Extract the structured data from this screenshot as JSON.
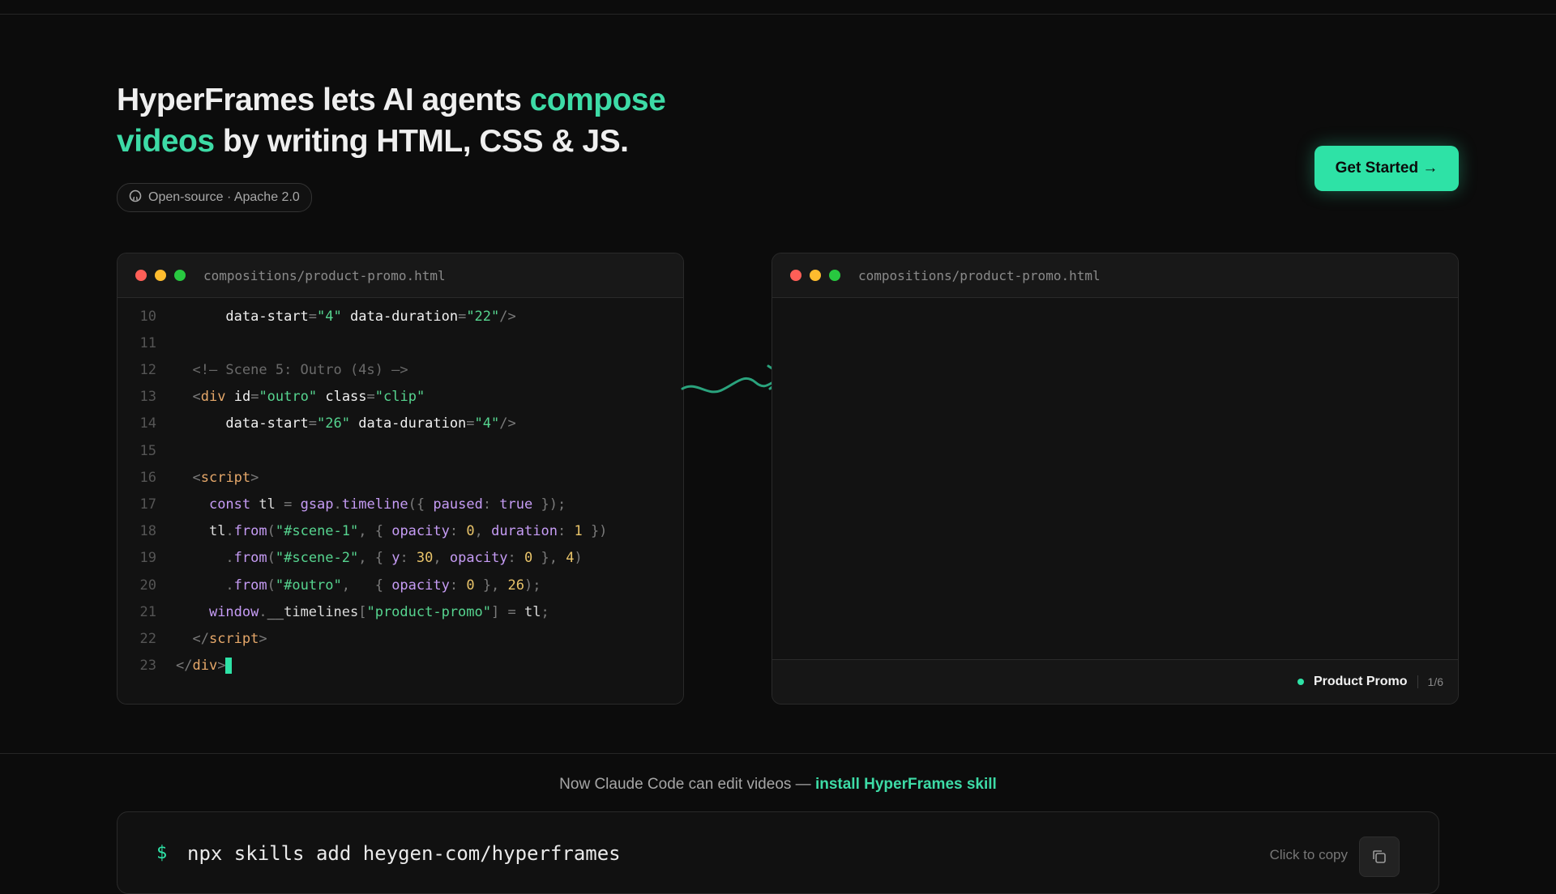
{
  "hero": {
    "headline_part1": "HyperFrames lets AI agents ",
    "headline_accent1": "compose videos",
    "headline_part2": " by writing HTML, CSS & JS.",
    "license": "Open-source · Apache 2.0",
    "cta": "Get Started →"
  },
  "code_window": {
    "filename": "compositions/product-promo.html",
    "lines": [
      {
        "n": "10",
        "tokens": [
          [
            "",
            "      "
          ],
          [
            "tk-attr",
            "data-start"
          ],
          [
            "tk-pun",
            "="
          ],
          [
            "tk-str",
            "\"4\""
          ],
          [
            "",
            " "
          ],
          [
            "tk-attr",
            "data-duration"
          ],
          [
            "tk-pun",
            "="
          ],
          [
            "tk-str",
            "\"22\""
          ],
          [
            "tk-pun",
            "/>"
          ]
        ]
      },
      {
        "n": "11",
        "tokens": []
      },
      {
        "n": "12",
        "tokens": [
          [
            "",
            "  "
          ],
          [
            "tk-com",
            "<!— Scene 5: Outro (4s) —>"
          ]
        ]
      },
      {
        "n": "13",
        "tokens": [
          [
            "",
            "  "
          ],
          [
            "tk-pun",
            "<"
          ],
          [
            "tk-tag",
            "div"
          ],
          [
            "",
            " "
          ],
          [
            "tk-attr",
            "id"
          ],
          [
            "tk-pun",
            "="
          ],
          [
            "tk-str",
            "\"outro\""
          ],
          [
            "",
            " "
          ],
          [
            "tk-attr",
            "class"
          ],
          [
            "tk-pun",
            "="
          ],
          [
            "tk-str",
            "\"clip\""
          ]
        ]
      },
      {
        "n": "14",
        "tokens": [
          [
            "",
            "      "
          ],
          [
            "tk-attr",
            "data-start"
          ],
          [
            "tk-pun",
            "="
          ],
          [
            "tk-str",
            "\"26\""
          ],
          [
            "",
            " "
          ],
          [
            "tk-attr",
            "data-duration"
          ],
          [
            "tk-pun",
            "="
          ],
          [
            "tk-str",
            "\"4\""
          ],
          [
            "tk-pun",
            "/>"
          ]
        ]
      },
      {
        "n": "15",
        "tokens": []
      },
      {
        "n": "16",
        "tokens": [
          [
            "",
            "  "
          ],
          [
            "tk-pun",
            "<"
          ],
          [
            "tk-tag",
            "script"
          ],
          [
            "tk-pun",
            ">"
          ]
        ]
      },
      {
        "n": "17",
        "tokens": [
          [
            "",
            "    "
          ],
          [
            "tk-kw",
            "const"
          ],
          [
            "tk-id",
            " tl "
          ],
          [
            "tk-pun",
            "= "
          ],
          [
            "tk-kw",
            "gsap"
          ],
          [
            "tk-pun",
            "."
          ],
          [
            "tk-kw",
            "timeline"
          ],
          [
            "tk-pun",
            "({ "
          ],
          [
            "tk-kw",
            "paused"
          ],
          [
            "tk-pun",
            ": "
          ],
          [
            "tk-kw",
            "true"
          ],
          [
            "tk-pun",
            " });"
          ]
        ]
      },
      {
        "n": "18",
        "tokens": [
          [
            "",
            "    "
          ],
          [
            "tk-id",
            "tl"
          ],
          [
            "tk-pun",
            "."
          ],
          [
            "tk-kw",
            "from"
          ],
          [
            "tk-pun",
            "("
          ],
          [
            "tk-str",
            "\"#scene-1\""
          ],
          [
            "tk-pun",
            ", { "
          ],
          [
            "tk-kw",
            "opacity"
          ],
          [
            "tk-pun",
            ": "
          ],
          [
            "tk-num",
            "0"
          ],
          [
            "tk-pun",
            ", "
          ],
          [
            "tk-kw",
            "duration"
          ],
          [
            "tk-pun",
            ": "
          ],
          [
            "tk-num",
            "1"
          ],
          [
            "tk-pun",
            " })"
          ]
        ]
      },
      {
        "n": "19",
        "tokens": [
          [
            "",
            "      "
          ],
          [
            "tk-pun",
            "."
          ],
          [
            "tk-kw",
            "from"
          ],
          [
            "tk-pun",
            "("
          ],
          [
            "tk-str",
            "\"#scene-2\""
          ],
          [
            "tk-pun",
            ", { "
          ],
          [
            "tk-kw",
            "y"
          ],
          [
            "tk-pun",
            ": "
          ],
          [
            "tk-num",
            "30"
          ],
          [
            "tk-pun",
            ", "
          ],
          [
            "tk-kw",
            "opacity"
          ],
          [
            "tk-pun",
            ": "
          ],
          [
            "tk-num",
            "0"
          ],
          [
            "tk-pun",
            " }, "
          ],
          [
            "tk-num",
            "4"
          ],
          [
            "tk-pun",
            ")"
          ]
        ]
      },
      {
        "n": "20",
        "tokens": [
          [
            "",
            "      "
          ],
          [
            "tk-pun",
            "."
          ],
          [
            "tk-kw",
            "from"
          ],
          [
            "tk-pun",
            "("
          ],
          [
            "tk-str",
            "\"#outro\""
          ],
          [
            "tk-pun",
            ",   { "
          ],
          [
            "tk-kw",
            "opacity"
          ],
          [
            "tk-pun",
            ": "
          ],
          [
            "tk-num",
            "0"
          ],
          [
            "tk-pun",
            " }, "
          ],
          [
            "tk-num",
            "26"
          ],
          [
            "tk-pun",
            ");"
          ]
        ]
      },
      {
        "n": "21",
        "tokens": [
          [
            "",
            "    "
          ],
          [
            "tk-kw",
            "window"
          ],
          [
            "tk-pun",
            "."
          ],
          [
            "tk-id",
            "__timelines"
          ],
          [
            "tk-pun",
            "["
          ],
          [
            "tk-str",
            "\"product-promo\""
          ],
          [
            "tk-pun",
            "] = "
          ],
          [
            "tk-id",
            "tl"
          ],
          [
            "tk-pun",
            ";"
          ]
        ]
      },
      {
        "n": "22",
        "tokens": [
          [
            "",
            "  "
          ],
          [
            "tk-pun",
            "</"
          ],
          [
            "tk-tag",
            "script"
          ],
          [
            "tk-pun",
            ">"
          ]
        ]
      },
      {
        "n": "23",
        "tokens": [
          [
            "tk-pun",
            "</"
          ],
          [
            "tk-tag",
            "div"
          ],
          [
            "tk-pun",
            ">"
          ]
        ],
        "caret": true
      }
    ]
  },
  "preview_window": {
    "filename": "compositions/product-promo.html",
    "scene_name": "Product Promo",
    "scene_count": "1/6"
  },
  "install": {
    "note": "Now Claude Code can edit videos — ",
    "link": "install HyperFrames skill",
    "prompt": "$",
    "command": "npx skills add heygen-com/hyperframes",
    "copy_label": "Click to copy"
  },
  "colors": {
    "accent": "#2ee2a6",
    "background": "#0c0c0c"
  }
}
